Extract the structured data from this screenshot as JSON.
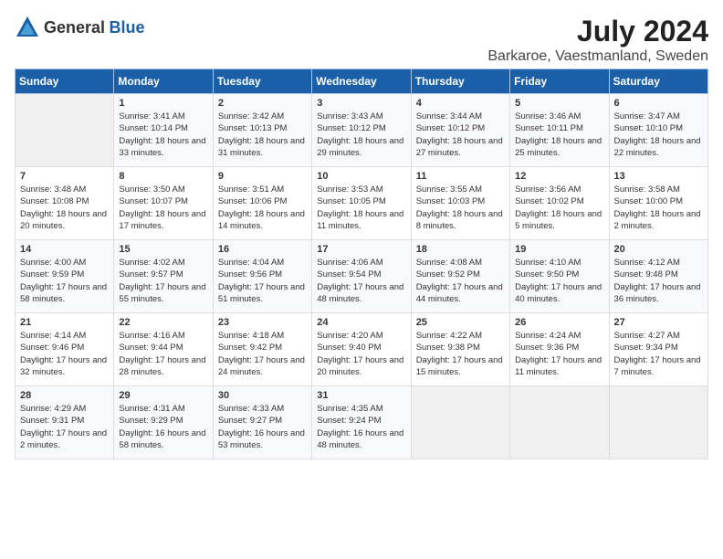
{
  "logo": {
    "general": "General",
    "blue": "Blue"
  },
  "title": {
    "month_year": "July 2024",
    "location": "Barkaroe, Vaestmanland, Sweden"
  },
  "weekdays": [
    "Sunday",
    "Monday",
    "Tuesday",
    "Wednesday",
    "Thursday",
    "Friday",
    "Saturday"
  ],
  "weeks": [
    [
      {
        "day": "",
        "empty": true
      },
      {
        "day": "1",
        "sunrise": "Sunrise: 3:41 AM",
        "sunset": "Sunset: 10:14 PM",
        "daylight": "Daylight: 18 hours and 33 minutes."
      },
      {
        "day": "2",
        "sunrise": "Sunrise: 3:42 AM",
        "sunset": "Sunset: 10:13 PM",
        "daylight": "Daylight: 18 hours and 31 minutes."
      },
      {
        "day": "3",
        "sunrise": "Sunrise: 3:43 AM",
        "sunset": "Sunset: 10:12 PM",
        "daylight": "Daylight: 18 hours and 29 minutes."
      },
      {
        "day": "4",
        "sunrise": "Sunrise: 3:44 AM",
        "sunset": "Sunset: 10:12 PM",
        "daylight": "Daylight: 18 hours and 27 minutes."
      },
      {
        "day": "5",
        "sunrise": "Sunrise: 3:46 AM",
        "sunset": "Sunset: 10:11 PM",
        "daylight": "Daylight: 18 hours and 25 minutes."
      },
      {
        "day": "6",
        "sunrise": "Sunrise: 3:47 AM",
        "sunset": "Sunset: 10:10 PM",
        "daylight": "Daylight: 18 hours and 22 minutes."
      }
    ],
    [
      {
        "day": "7",
        "sunrise": "Sunrise: 3:48 AM",
        "sunset": "Sunset: 10:08 PM",
        "daylight": "Daylight: 18 hours and 20 minutes."
      },
      {
        "day": "8",
        "sunrise": "Sunrise: 3:50 AM",
        "sunset": "Sunset: 10:07 PM",
        "daylight": "Daylight: 18 hours and 17 minutes."
      },
      {
        "day": "9",
        "sunrise": "Sunrise: 3:51 AM",
        "sunset": "Sunset: 10:06 PM",
        "daylight": "Daylight: 18 hours and 14 minutes."
      },
      {
        "day": "10",
        "sunrise": "Sunrise: 3:53 AM",
        "sunset": "Sunset: 10:05 PM",
        "daylight": "Daylight: 18 hours and 11 minutes."
      },
      {
        "day": "11",
        "sunrise": "Sunrise: 3:55 AM",
        "sunset": "Sunset: 10:03 PM",
        "daylight": "Daylight: 18 hours and 8 minutes."
      },
      {
        "day": "12",
        "sunrise": "Sunrise: 3:56 AM",
        "sunset": "Sunset: 10:02 PM",
        "daylight": "Daylight: 18 hours and 5 minutes."
      },
      {
        "day": "13",
        "sunrise": "Sunrise: 3:58 AM",
        "sunset": "Sunset: 10:00 PM",
        "daylight": "Daylight: 18 hours and 2 minutes."
      }
    ],
    [
      {
        "day": "14",
        "sunrise": "Sunrise: 4:00 AM",
        "sunset": "Sunset: 9:59 PM",
        "daylight": "Daylight: 17 hours and 58 minutes."
      },
      {
        "day": "15",
        "sunrise": "Sunrise: 4:02 AM",
        "sunset": "Sunset: 9:57 PM",
        "daylight": "Daylight: 17 hours and 55 minutes."
      },
      {
        "day": "16",
        "sunrise": "Sunrise: 4:04 AM",
        "sunset": "Sunset: 9:56 PM",
        "daylight": "Daylight: 17 hours and 51 minutes."
      },
      {
        "day": "17",
        "sunrise": "Sunrise: 4:06 AM",
        "sunset": "Sunset: 9:54 PM",
        "daylight": "Daylight: 17 hours and 48 minutes."
      },
      {
        "day": "18",
        "sunrise": "Sunrise: 4:08 AM",
        "sunset": "Sunset: 9:52 PM",
        "daylight": "Daylight: 17 hours and 44 minutes."
      },
      {
        "day": "19",
        "sunrise": "Sunrise: 4:10 AM",
        "sunset": "Sunset: 9:50 PM",
        "daylight": "Daylight: 17 hours and 40 minutes."
      },
      {
        "day": "20",
        "sunrise": "Sunrise: 4:12 AM",
        "sunset": "Sunset: 9:48 PM",
        "daylight": "Daylight: 17 hours and 36 minutes."
      }
    ],
    [
      {
        "day": "21",
        "sunrise": "Sunrise: 4:14 AM",
        "sunset": "Sunset: 9:46 PM",
        "daylight": "Daylight: 17 hours and 32 minutes."
      },
      {
        "day": "22",
        "sunrise": "Sunrise: 4:16 AM",
        "sunset": "Sunset: 9:44 PM",
        "daylight": "Daylight: 17 hours and 28 minutes."
      },
      {
        "day": "23",
        "sunrise": "Sunrise: 4:18 AM",
        "sunset": "Sunset: 9:42 PM",
        "daylight": "Daylight: 17 hours and 24 minutes."
      },
      {
        "day": "24",
        "sunrise": "Sunrise: 4:20 AM",
        "sunset": "Sunset: 9:40 PM",
        "daylight": "Daylight: 17 hours and 20 minutes."
      },
      {
        "day": "25",
        "sunrise": "Sunrise: 4:22 AM",
        "sunset": "Sunset: 9:38 PM",
        "daylight": "Daylight: 17 hours and 15 minutes."
      },
      {
        "day": "26",
        "sunrise": "Sunrise: 4:24 AM",
        "sunset": "Sunset: 9:36 PM",
        "daylight": "Daylight: 17 hours and 11 minutes."
      },
      {
        "day": "27",
        "sunrise": "Sunrise: 4:27 AM",
        "sunset": "Sunset: 9:34 PM",
        "daylight": "Daylight: 17 hours and 7 minutes."
      }
    ],
    [
      {
        "day": "28",
        "sunrise": "Sunrise: 4:29 AM",
        "sunset": "Sunset: 9:31 PM",
        "daylight": "Daylight: 17 hours and 2 minutes."
      },
      {
        "day": "29",
        "sunrise": "Sunrise: 4:31 AM",
        "sunset": "Sunset: 9:29 PM",
        "daylight": "Daylight: 16 hours and 58 minutes."
      },
      {
        "day": "30",
        "sunrise": "Sunrise: 4:33 AM",
        "sunset": "Sunset: 9:27 PM",
        "daylight": "Daylight: 16 hours and 53 minutes."
      },
      {
        "day": "31",
        "sunrise": "Sunrise: 4:35 AM",
        "sunset": "Sunset: 9:24 PM",
        "daylight": "Daylight: 16 hours and 48 minutes."
      },
      {
        "day": "",
        "empty": true
      },
      {
        "day": "",
        "empty": true
      },
      {
        "day": "",
        "empty": true
      }
    ]
  ]
}
